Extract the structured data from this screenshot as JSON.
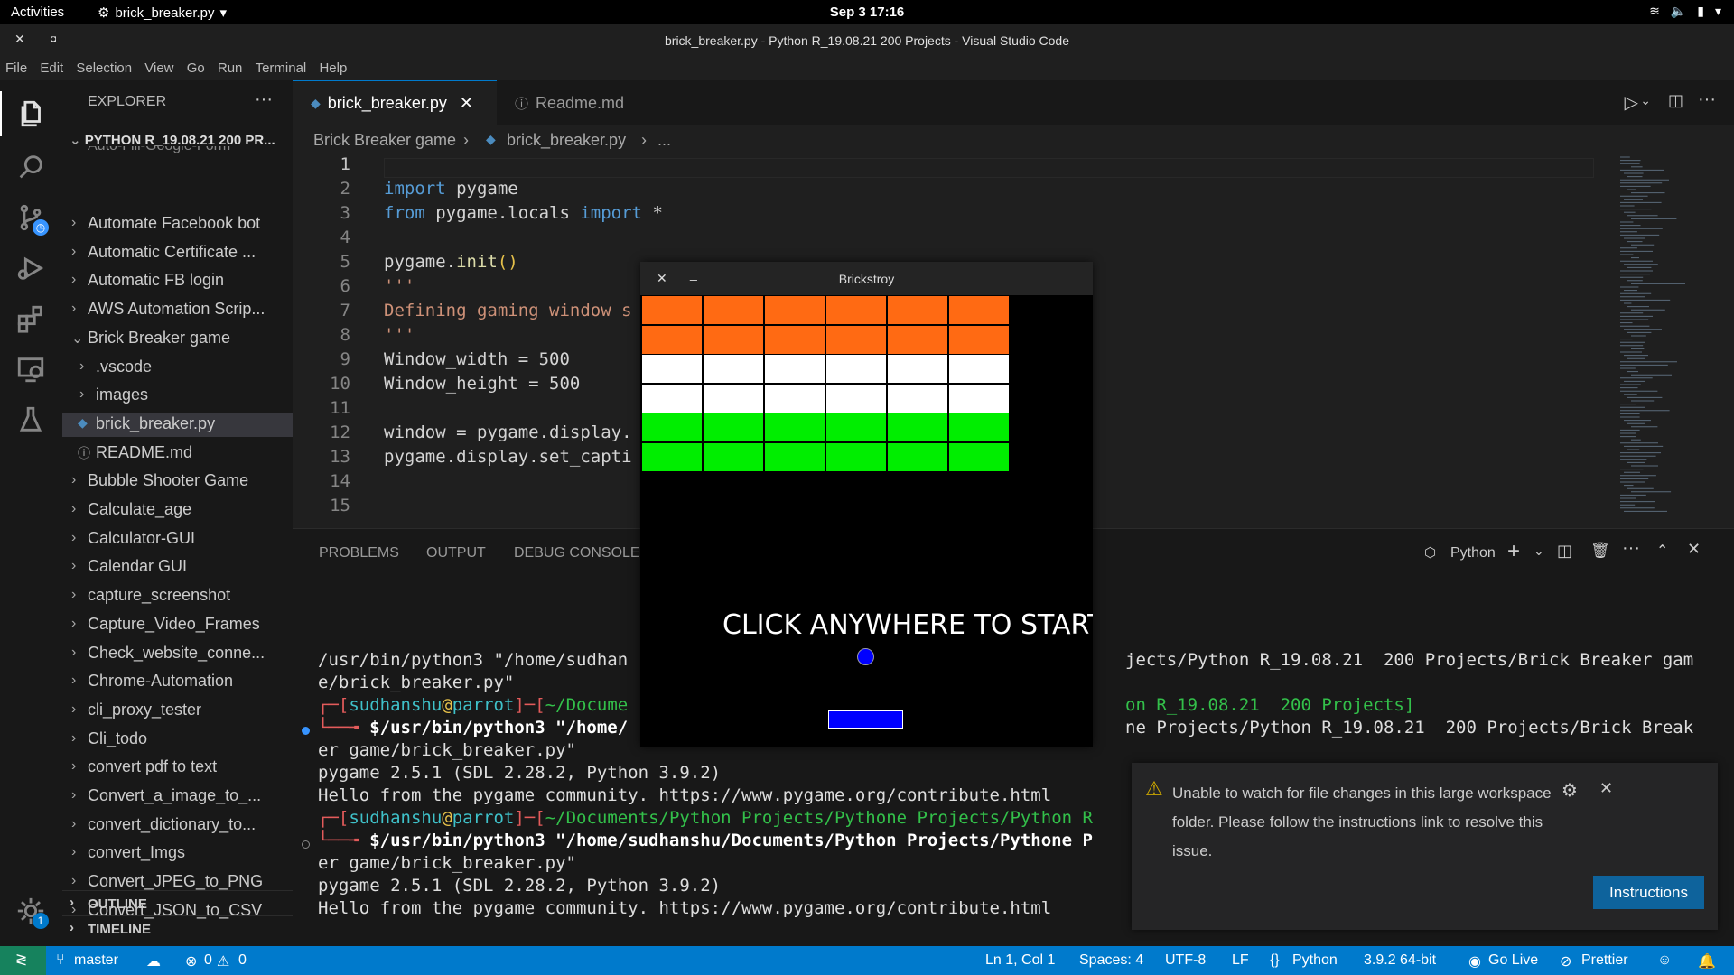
{
  "os_bar": {
    "activities": "Activities",
    "app": "brick_breaker.py",
    "clock": "Sep 3  17:16"
  },
  "window": {
    "title": "brick_breaker.py - Python R_19.08.21 200 Projects - Visual Studio Code"
  },
  "menu": [
    "File",
    "Edit",
    "Selection",
    "View",
    "Go",
    "Run",
    "Terminal",
    "Help"
  ],
  "sidebar": {
    "header": "EXPLORER",
    "project": "PYTHON R_19.08.21 200 PR...",
    "partial": "Auto-Fill-Google-Form",
    "items": [
      {
        "label": "Automate Facebook bot",
        "type": "folder"
      },
      {
        "label": "Automatic Certificate ...",
        "type": "folder"
      },
      {
        "label": "Automatic FB login",
        "type": "folder"
      },
      {
        "label": "AWS Automation Scrip...",
        "type": "folder"
      },
      {
        "label": "Brick Breaker game",
        "type": "open-folder"
      },
      {
        "label": ".vscode",
        "type": "subfolder"
      },
      {
        "label": "images",
        "type": "subfolder"
      },
      {
        "label": "brick_breaker.py",
        "type": "file-py"
      },
      {
        "label": "README.md",
        "type": "file-info"
      },
      {
        "label": "Bubble Shooter Game",
        "type": "folder"
      },
      {
        "label": "Calculate_age",
        "type": "folder"
      },
      {
        "label": "Calculator-GUI",
        "type": "folder"
      },
      {
        "label": "Calendar GUI",
        "type": "folder"
      },
      {
        "label": "capture_screenshot",
        "type": "folder"
      },
      {
        "label": "Capture_Video_Frames",
        "type": "folder"
      },
      {
        "label": "Check_website_conne...",
        "type": "folder"
      },
      {
        "label": "Chrome-Automation",
        "type": "folder"
      },
      {
        "label": "cli_proxy_tester",
        "type": "folder"
      },
      {
        "label": "Cli_todo",
        "type": "folder"
      },
      {
        "label": "convert pdf to text",
        "type": "folder"
      },
      {
        "label": "Convert_a_image_to_...",
        "type": "folder"
      },
      {
        "label": "convert_dictionary_to...",
        "type": "folder"
      },
      {
        "label": "convert_Imgs",
        "type": "folder"
      },
      {
        "label": "Convert_JPEG_to_PNG",
        "type": "folder"
      },
      {
        "label": "Convert_JSON_to_CSV",
        "type": "folder"
      }
    ],
    "outline": "OUTLINE",
    "timeline": "TIMELINE",
    "badge": "1"
  },
  "tabs": [
    {
      "label": "brick_breaker.py"
    },
    {
      "label": "Readme.md"
    }
  ],
  "breadcrumb": {
    "folder": "Brick Breaker game",
    "file": "brick_breaker.py",
    "more": "..."
  },
  "code_lines": [
    {
      "n": "1"
    },
    {
      "n": "2"
    },
    {
      "n": "3"
    },
    {
      "n": "4"
    },
    {
      "n": "5"
    },
    {
      "n": "6"
    },
    {
      "n": "7"
    },
    {
      "n": "8"
    },
    {
      "n": "9"
    },
    {
      "n": "10"
    },
    {
      "n": "11"
    },
    {
      "n": "12"
    },
    {
      "n": "13"
    },
    {
      "n": "14"
    },
    {
      "n": "15"
    }
  ],
  "code": {
    "l2a": "import",
    "l2b": " pygame",
    "l3a": "from",
    "l3b": " pygame.locals ",
    "l3c": "import",
    "l3d": " *",
    "l5a": "pygame.",
    "l5b": "init",
    "l5c": "()",
    "l7": "'''",
    "l8": "Defining gaming window s",
    "l9": "'''",
    "l10": "Window_width = 500",
    "l11": "Window_height = 500",
    "l13": "window = pygame.display.",
    "l14": "pygame.display.set_capti"
  },
  "panel": {
    "tabs": [
      "PROBLEMS",
      "OUTPUT",
      "DEBUG CONSOLE"
    ],
    "shell": "Python"
  },
  "terminal": {
    "t1a": "/usr/bin/python3 \"/home/sudhan",
    "t1b": "jects/Python R_19.08.21  200 Projects/Brick Breaker gam",
    "t2": "e/brick_breaker.py\"",
    "t3user": "sudhanshu",
    "t3at": "@",
    "t3host": "parrot",
    "t3path": "~/Docume",
    "t3path2": "on R_19.08.21  200 Projects]",
    "t4a": "$/usr/bin/python3 \"/home/",
    "t4b": "ne Projects/Python R_19.08.21  200 Projects/Brick Break",
    "t5": "er game/brick_breaker.py\"",
    "t6": "pygame 2.5.1 (SDL 2.28.2, Python 3.9.2)",
    "t7": "Hello from the pygame community. https://www.pygame.org/contribute.html",
    "t8user": "sudhanshu",
    "t8host": "parrot",
    "t8path": "~/Documents/Python Projects/Pythone Projects/Python R",
    "t9": "$/usr/bin/python3 \"/home/sudhanshu/Documents/Python Projects/Pythone P",
    "t10": "er game/brick_breaker.py\"",
    "t11": "pygame 2.5.1 (SDL 2.28.2, Python 3.9.2)",
    "t12": "Hello from the pygame community. https://www.pygame.org/contribute.html"
  },
  "game": {
    "title": "Brickstroy",
    "prompt": "CLICK ANYWHERE TO START",
    "brick_colors": [
      "#ff6a13",
      "#ff6a13",
      "#ffffff",
      "#ffffff",
      "#00ee00",
      "#00ee00"
    ],
    "ball_color": "#0000ff",
    "paddle_color": "#0000ff"
  },
  "notification": {
    "message": "Unable to watch for file changes in this large workspace folder. Please follow the instructions link to resolve this issue.",
    "button": "Instructions"
  },
  "status": {
    "branch": "master",
    "errors": "0",
    "warnings": "0",
    "position": "Ln 1, Col 1",
    "spaces": "Spaces: 4",
    "encoding": "UTF-8",
    "eol": "LF",
    "language": "Python",
    "interpreter": "3.9.2 64-bit",
    "golive": "Go Live",
    "prettier": "Prettier"
  },
  "colors": {
    "accent": "#007acc",
    "sidebar_bg": "#181818",
    "editor_bg": "#1f1f1f"
  }
}
